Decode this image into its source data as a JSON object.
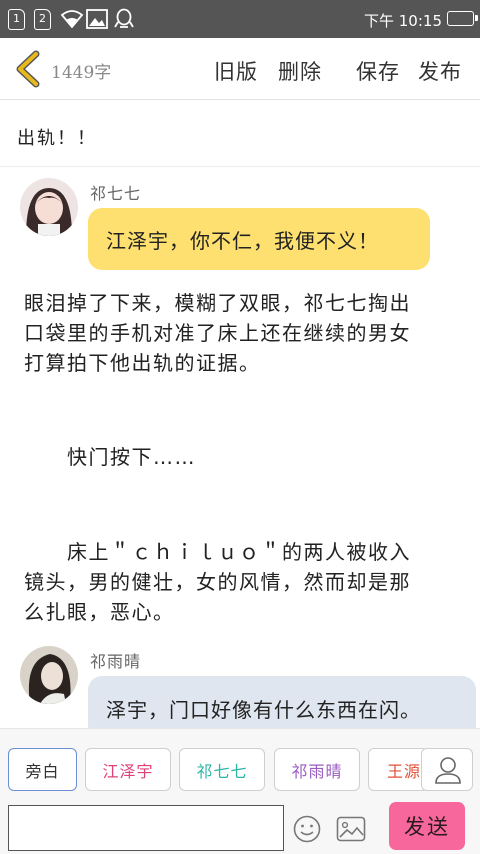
{
  "status_bar": {
    "sim1": "1",
    "sim2": "2",
    "time": "下午 10:15"
  },
  "header": {
    "word_count": "1449字",
    "old_version": "旧版",
    "delete": "删除",
    "save": "保存",
    "publish": "发布"
  },
  "chapter": {
    "title": "出轨！！"
  },
  "messages": [
    {
      "speaker": "祁七七",
      "text": "江泽宇，你不仁，我便不义！",
      "bubble_color": "#fde06f"
    }
  ],
  "narration": [
    {
      "lines": [
        "眼泪掉了下来，模糊了双眼，祁七七掏出",
        "口袋里的手机对准了床上还在继续的男女",
        "打算拍下他出轨的证据。"
      ]
    },
    {
      "lines": [
        "　　快门按下……"
      ]
    },
    {
      "lines": [
        "　　床上＂ｃｈｉｌｕｏ＂的两人被收入",
        "镜头，男的健壮，女的风情，然而却是那",
        "么扎眼，恶心。"
      ]
    }
  ],
  "messages2": [
    {
      "speaker": "祁雨晴",
      "text": "泽宇，门口好像有什么东西在闪。",
      "bubble_color": "#dfe6ef"
    }
  ],
  "characters": [
    {
      "name": "旁白",
      "color": "#333333"
    },
    {
      "name": "江泽宇",
      "color": "#e0407a"
    },
    {
      "name": "祁七七",
      "color": "#2ab5a5"
    },
    {
      "name": "祁雨晴",
      "color": "#9a5bc0"
    },
    {
      "name": "王源",
      "color": "#e0503a"
    }
  ],
  "input": {
    "value": "",
    "send": "发送"
  },
  "colors": {
    "status_bar": "#555555",
    "send_button": "#f7679b",
    "back_arrow": "#e8b91c"
  }
}
